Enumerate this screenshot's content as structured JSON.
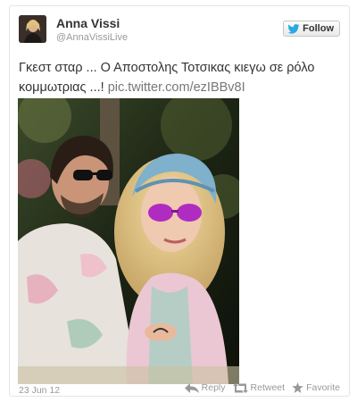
{
  "user": {
    "name": "Anna Vissi",
    "handle": "@AnnaVissiLive"
  },
  "follow_button": {
    "label": "Follow",
    "icon": "twitter-bird-icon",
    "color": "#2ba9e1"
  },
  "tweet": {
    "text": "Γκεστ σταρ ... Ο Αποστολης Τοτσικας κιεγω σε ρόλο κομμωτριας ...!",
    "link": "pic.twitter.com/ezIBBv8I",
    "photo": "photo of a man in sunglasses and a pastel shirt next to a blonde woman in purple sunglasses and a blue headscarf"
  },
  "footer": {
    "timestamp": "23 Jun 12",
    "actions": [
      {
        "label": "Reply",
        "icon": "reply-icon"
      },
      {
        "label": "Retweet",
        "icon": "retweet-icon"
      },
      {
        "label": "Favorite",
        "icon": "star-icon"
      }
    ]
  },
  "colors": {
    "text": "#333333",
    "muted": "#999999",
    "twitter_blue": "#2ba9e1"
  }
}
